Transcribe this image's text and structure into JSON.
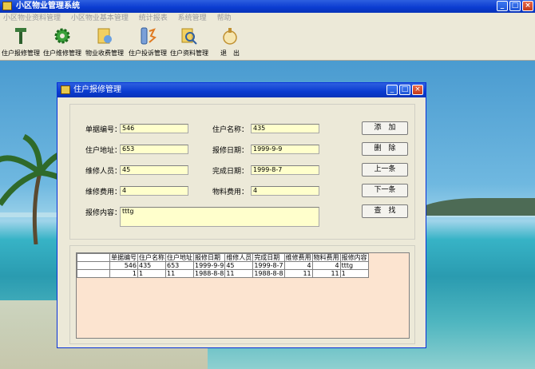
{
  "window": {
    "title": "小区物业管理系统",
    "buttons": [
      "_",
      "□",
      "×"
    ]
  },
  "menu": [
    "小区物业资料管理",
    "小区物业基本管理",
    "统计报表",
    "系统管理",
    "帮助"
  ],
  "toolbar": [
    {
      "label": "住户报修管理",
      "icon": "hammer-icon"
    },
    {
      "label": "住户维修管理",
      "icon": "gear-icon"
    },
    {
      "label": "物业收费管理",
      "icon": "billing-icon"
    },
    {
      "label": "住户投诉管理",
      "icon": "complaint-icon"
    },
    {
      "label": "住户资料管理",
      "icon": "search-icon"
    },
    {
      "label": "退　出",
      "icon": "exit-icon"
    }
  ],
  "dialog": {
    "title": "住户报修管理",
    "labels": {
      "bill_no": "单据编号：",
      "address": "住户地址：",
      "repair_person": "维修人员：",
      "repair_fee": "维修费用：",
      "content": "报修内容：",
      "name": "住户名称：",
      "report_date": "报修日期：",
      "finish_date": "完成日期：",
      "material_fee": "物料费用："
    },
    "values": {
      "bill_no": "546",
      "address": "653",
      "repair_person": "45",
      "repair_fee": "4",
      "content": "tttg",
      "name": "435",
      "report_date": "1999-9-9",
      "finish_date": "1999-8-7",
      "material_fee": "4"
    },
    "buttons": {
      "add": "添　加",
      "delete": "删　除",
      "prev": "上一条",
      "next": "下一条",
      "find": "查　找"
    },
    "grid": {
      "columns": [
        "单据编号",
        "住户名称",
        "住户地址",
        "报修日期",
        "维修人员",
        "完成日期",
        "维修费用",
        "物料费用",
        "报修内容"
      ],
      "rows": [
        [
          "546",
          "435",
          "653",
          "1999-9-9",
          "45",
          "1999-8-7",
          "4",
          "4",
          "tttg"
        ],
        [
          "1",
          "1",
          "11",
          "1988-8-8",
          "11",
          "1988-8-8",
          "11",
          "11",
          "1"
        ]
      ]
    }
  }
}
